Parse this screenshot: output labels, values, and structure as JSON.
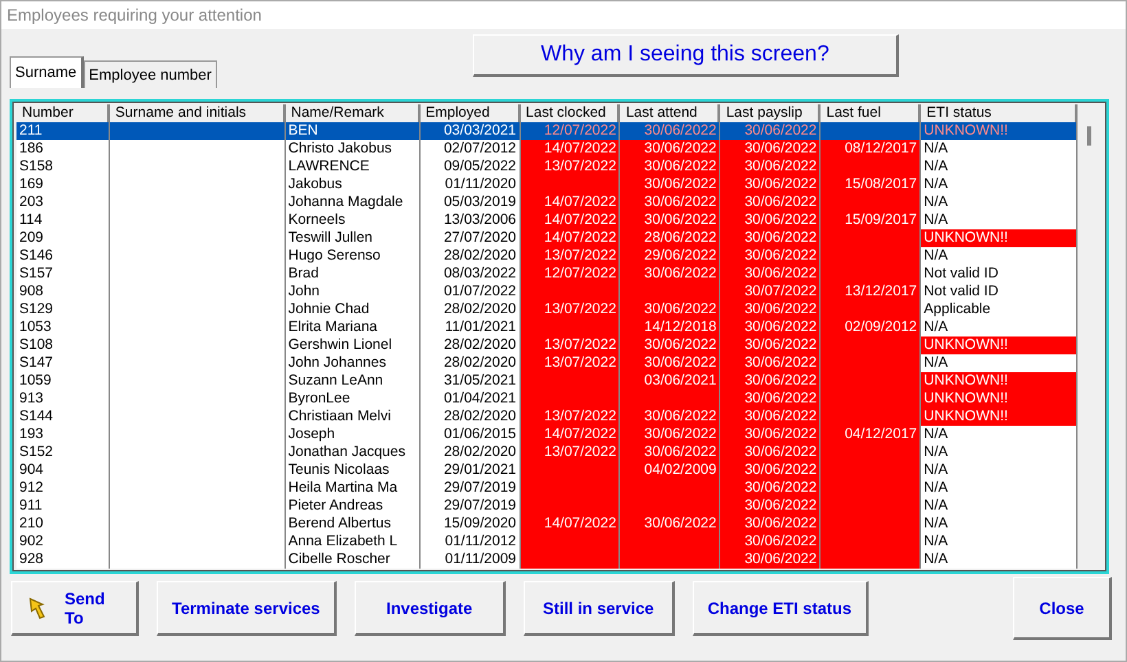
{
  "window": {
    "title": "Employees requiring your attention"
  },
  "tabs": [
    {
      "label": "Surname",
      "selected": true
    },
    {
      "label": "Employee number",
      "selected": false
    }
  ],
  "help_button": "Why am I seeing this screen?",
  "table": {
    "columns": [
      {
        "label": "Number",
        "alert": false
      },
      {
        "label": "Surname and initials",
        "alert": false
      },
      {
        "label": "Name/Remark",
        "alert": false
      },
      {
        "label": "Employed",
        "alert": false
      },
      {
        "label": "Last clocked",
        "alert": true
      },
      {
        "label": "Last attend",
        "alert": true
      },
      {
        "label": "Last payslip",
        "alert": true
      },
      {
        "label": "Last fuel",
        "alert": true
      },
      {
        "label": "ETI status",
        "alert": false
      }
    ],
    "rows": [
      {
        "selected": true,
        "eti_alert": true,
        "cells": [
          "211",
          "",
          "BEN",
          "03/03/2021",
          "12/07/2022",
          "30/06/2022",
          "30/06/2022",
          "",
          "UNKNOWN!!"
        ]
      },
      {
        "selected": false,
        "eti_alert": false,
        "cells": [
          "186",
          "",
          "Christo Jakobus",
          "02/07/2012",
          "14/07/2022",
          "30/06/2022",
          "30/06/2022",
          "08/12/2017",
          "N/A"
        ]
      },
      {
        "selected": false,
        "eti_alert": false,
        "cells": [
          "S158",
          "",
          "LAWRENCE",
          "09/05/2022",
          "13/07/2022",
          "30/06/2022",
          "30/06/2022",
          "",
          "N/A"
        ]
      },
      {
        "selected": false,
        "eti_alert": false,
        "cells": [
          "169",
          "",
          "Jakobus",
          "01/11/2020",
          "",
          "30/06/2022",
          "30/06/2022",
          "15/08/2017",
          "N/A"
        ]
      },
      {
        "selected": false,
        "eti_alert": false,
        "cells": [
          "203",
          "",
          "Johanna Magdale",
          "05/03/2019",
          "14/07/2022",
          "30/06/2022",
          "30/06/2022",
          "",
          "N/A"
        ]
      },
      {
        "selected": false,
        "eti_alert": false,
        "cells": [
          "114",
          "",
          "Korneels",
          "13/03/2006",
          "14/07/2022",
          "30/06/2022",
          "30/06/2022",
          "15/09/2017",
          "N/A"
        ]
      },
      {
        "selected": false,
        "eti_alert": true,
        "cells": [
          "209",
          "",
          "Teswill Jullen",
          "27/07/2020",
          "14/07/2022",
          "28/06/2022",
          "30/06/2022",
          "",
          "UNKNOWN!!"
        ]
      },
      {
        "selected": false,
        "eti_alert": false,
        "cells": [
          "S146",
          "",
          "Hugo Serenso",
          "28/02/2020",
          "13/07/2022",
          "29/06/2022",
          "30/06/2022",
          "",
          "N/A"
        ]
      },
      {
        "selected": false,
        "eti_alert": false,
        "cells": [
          "S157",
          "",
          "Brad",
          "08/03/2022",
          "12/07/2022",
          "30/06/2022",
          "30/06/2022",
          "",
          "Not valid ID"
        ]
      },
      {
        "selected": false,
        "eti_alert": false,
        "cells": [
          "908",
          "",
          "John",
          "01/07/2022",
          "",
          "",
          "30/07/2022",
          "13/12/2017",
          "Not valid ID"
        ]
      },
      {
        "selected": false,
        "eti_alert": false,
        "cells": [
          "S129",
          "",
          "Johnie Chad",
          "28/02/2020",
          "13/07/2022",
          "30/06/2022",
          "30/06/2022",
          "",
          "Applicable"
        ]
      },
      {
        "selected": false,
        "eti_alert": false,
        "cells": [
          "1053",
          "",
          "Elrita Mariana",
          "11/01/2021",
          "",
          "14/12/2018",
          "30/06/2022",
          "02/09/2012",
          "N/A"
        ]
      },
      {
        "selected": false,
        "eti_alert": true,
        "cells": [
          "S108",
          "",
          "Gershwin Lionel",
          "28/02/2020",
          "13/07/2022",
          "30/06/2022",
          "30/06/2022",
          "",
          "UNKNOWN!!"
        ]
      },
      {
        "selected": false,
        "eti_alert": false,
        "cells": [
          "S147",
          "",
          "John Johannes",
          "28/02/2020",
          "13/07/2022",
          "30/06/2022",
          "30/06/2022",
          "",
          "N/A"
        ]
      },
      {
        "selected": false,
        "eti_alert": true,
        "cells": [
          "1059",
          "",
          "Suzann LeAnn",
          "31/05/2021",
          "",
          "03/06/2021",
          "30/06/2022",
          "",
          "UNKNOWN!!"
        ]
      },
      {
        "selected": false,
        "eti_alert": true,
        "cells": [
          "913",
          "",
          "ByronLee",
          "01/04/2021",
          "",
          "",
          "30/06/2022",
          "",
          "UNKNOWN!!"
        ]
      },
      {
        "selected": false,
        "eti_alert": true,
        "cells": [
          "S144",
          "",
          "Christiaan Melvi",
          "28/02/2020",
          "13/07/2022",
          "30/06/2022",
          "30/06/2022",
          "",
          "UNKNOWN!!"
        ]
      },
      {
        "selected": false,
        "eti_alert": false,
        "cells": [
          "193",
          "",
          "Joseph",
          "01/06/2015",
          "14/07/2022",
          "30/06/2022",
          "30/06/2022",
          "04/12/2017",
          "N/A"
        ]
      },
      {
        "selected": false,
        "eti_alert": false,
        "cells": [
          "S152",
          "",
          "Jonathan Jacques",
          "28/02/2020",
          "13/07/2022",
          "30/06/2022",
          "30/06/2022",
          "",
          "N/A"
        ]
      },
      {
        "selected": false,
        "eti_alert": false,
        "cells": [
          "904",
          "",
          "Teunis Nicolaas",
          "29/01/2021",
          "",
          "04/02/2009",
          "30/06/2022",
          "",
          "N/A"
        ]
      },
      {
        "selected": false,
        "eti_alert": false,
        "cells": [
          "912",
          "",
          "Heila Martina Ma",
          "29/07/2019",
          "",
          "",
          "30/06/2022",
          "",
          "N/A"
        ]
      },
      {
        "selected": false,
        "eti_alert": false,
        "cells": [
          "911",
          "",
          "Pieter Andreas",
          "29/07/2019",
          "",
          "",
          "30/06/2022",
          "",
          "N/A"
        ]
      },
      {
        "selected": false,
        "eti_alert": false,
        "cells": [
          "210",
          "",
          "Berend Albertus",
          "15/09/2020",
          "14/07/2022",
          "30/06/2022",
          "30/06/2022",
          "",
          "N/A"
        ]
      },
      {
        "selected": false,
        "eti_alert": false,
        "cells": [
          "902",
          "",
          "Anna Elizabeth L",
          "01/11/2012",
          "",
          "",
          "30/06/2022",
          "",
          "N/A"
        ]
      },
      {
        "selected": false,
        "eti_alert": false,
        "cells": [
          "928",
          "",
          "Cibelle Roscher",
          "01/11/2009",
          "",
          "",
          "30/06/2022",
          "",
          "N/A"
        ]
      }
    ]
  },
  "buttons": [
    {
      "label": "Send To",
      "kind": "send"
    },
    {
      "label": "Terminate services",
      "kind": "plain"
    },
    {
      "label": "Investigate",
      "kind": "plain"
    },
    {
      "label": "Still in service",
      "kind": "plain"
    },
    {
      "label": "Change ETI status",
      "kind": "plain"
    }
  ],
  "close_button": "Close"
}
